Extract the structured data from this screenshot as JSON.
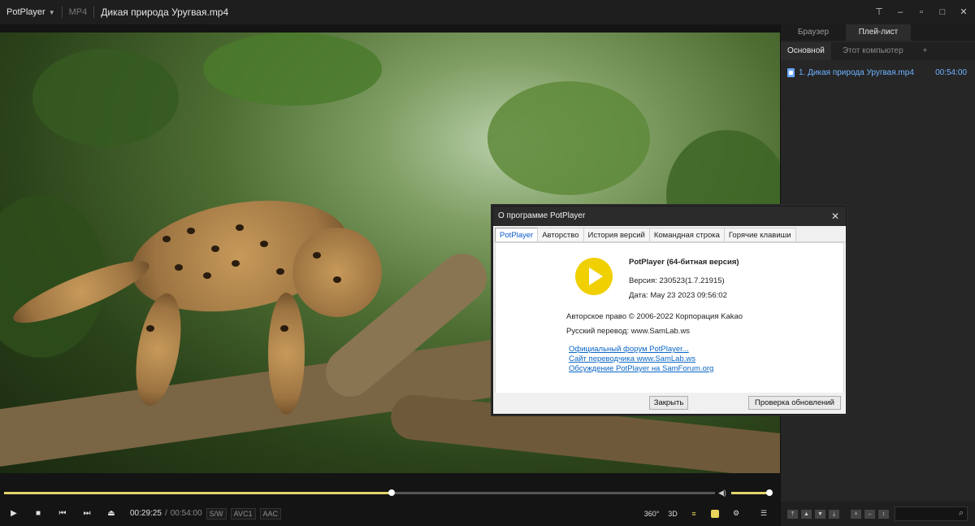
{
  "titlebar": {
    "app_name": "PotPlayer",
    "format": "MP4",
    "file_title": "Дикая природа Уругвая.mp4"
  },
  "playback": {
    "current_time": "00:29:25",
    "separator": "/",
    "total_time": "00:54:00",
    "progress_fraction": 0.545,
    "volume_fraction": 1.0,
    "badges": [
      "S/W",
      "AVC1",
      "AAC"
    ],
    "right_buttons": [
      "360°",
      "3D"
    ]
  },
  "panel": {
    "tabs": [
      "Браузер",
      "Плей-лист"
    ],
    "active_tab": "Плей-лист",
    "subtabs": [
      "Основной",
      "Этот компьютер",
      "+"
    ],
    "active_subtab": "Основной",
    "items": [
      {
        "name": "1. Дикая природа Уругвая.mp4",
        "duration": "00:54:00"
      }
    ]
  },
  "dialog": {
    "title": "О программе PotPlayer",
    "tabs": [
      "PotPlayer",
      "Авторство",
      "История версий",
      "Командная строка",
      "Горячие клавиши"
    ],
    "active_tab": "PotPlayer",
    "product": "PotPlayer (64-битная версия)",
    "version": "Версия: 230523(1.7.21915)",
    "date": "Дата: May 23 2023 09:56:02",
    "copyright": "Авторское право © 2006-2022 Корпорация Kakao",
    "translation": "Русский перевод: www.SamLab.ws",
    "links": [
      "Официальный форум PotPlayer...",
      "Сайт переводчика www.SamLab.ws",
      "Обсуждение PotPlayer на SamForum.org"
    ],
    "close_button": "Закрыть",
    "update_button": "Проверка обновлений",
    "logo_color": "#f0d000"
  },
  "colors": {
    "accent": "#e3d36b",
    "link": "#0b66c6",
    "playlist_item": "#6fb3ff"
  }
}
